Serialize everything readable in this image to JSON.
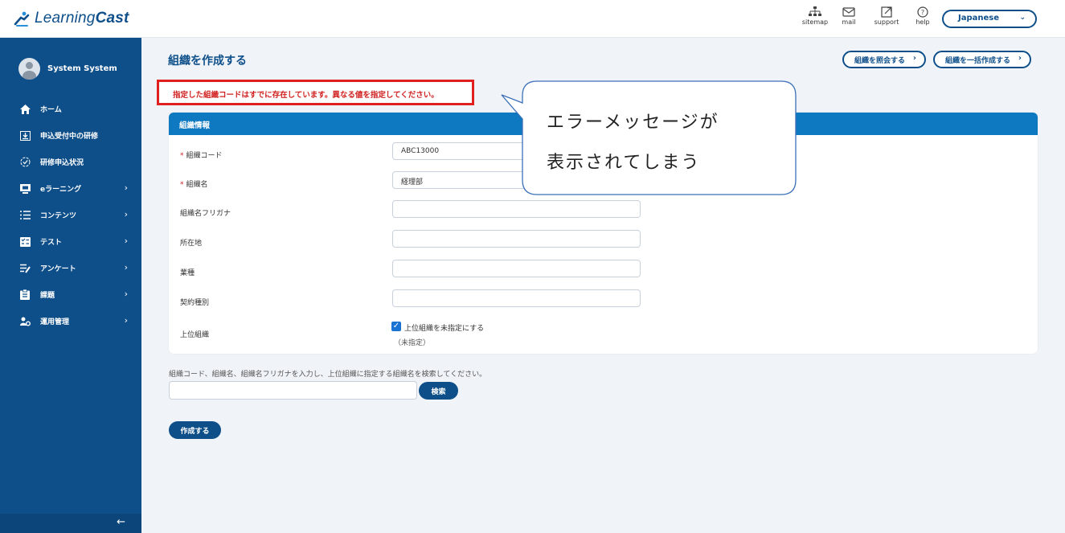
{
  "header": {
    "logo": {
      "text_light": "Learning",
      "text_bold": "Cast"
    },
    "icons": [
      {
        "name": "sitemap",
        "label": "sitemap"
      },
      {
        "name": "mail",
        "label": "mail"
      },
      {
        "name": "support",
        "label": "support"
      },
      {
        "name": "help",
        "label": "help"
      }
    ],
    "language": "Japanese"
  },
  "sidebar": {
    "user_name": "System System",
    "items": [
      {
        "label": "ホーム",
        "icon": "home-icon",
        "has_arrow": false
      },
      {
        "label": "申込受付中の研修",
        "icon": "download-icon",
        "has_arrow": false
      },
      {
        "label": "研修申込状況",
        "icon": "check-circle-icon",
        "has_arrow": false
      },
      {
        "label": "eラーニング",
        "icon": "monitor-icon",
        "has_arrow": true
      },
      {
        "label": "コンテンツ",
        "icon": "list-icon",
        "has_arrow": true
      },
      {
        "label": "テスト",
        "icon": "test-icon",
        "has_arrow": true
      },
      {
        "label": "アンケート",
        "icon": "survey-icon",
        "has_arrow": true
      },
      {
        "label": "課題",
        "icon": "clipboard-icon",
        "has_arrow": true
      },
      {
        "label": "運用管理",
        "icon": "admin-icon",
        "has_arrow": true
      }
    ],
    "collapse_glyph": "←"
  },
  "page": {
    "title": "組織を作成する",
    "actions": {
      "refer": "組織を照会する",
      "bulk_create": "組織を一括作成する",
      "arrow": "›"
    },
    "error_message": "指定した組織コードはすでに存在しています。異なる値を指定してください。"
  },
  "form": {
    "section_title": "組織情報",
    "required_mark": "*",
    "fields": [
      {
        "label": "組織コード",
        "required": true,
        "value": "ABC13000"
      },
      {
        "label": "組織名",
        "required": true,
        "value": "経理部"
      },
      {
        "label": "組織名フリガナ",
        "required": false,
        "value": ""
      },
      {
        "label": "所在地",
        "required": false,
        "value": ""
      },
      {
        "label": "業種",
        "required": false,
        "value": ""
      },
      {
        "label": "契約種別",
        "required": false,
        "value": ""
      }
    ],
    "parent": {
      "label": "上位組織",
      "checkbox_label": "上位組織を未指定にする",
      "checked": true,
      "status": "（未指定）"
    }
  },
  "search": {
    "hint": "組織コード、組織名、組織名フリガナを入力し、上位組織に指定する組織名を検索してください。",
    "value": "",
    "button": "検索"
  },
  "submit_button": "作成する",
  "callout": {
    "line1": "エラーメッセージが",
    "line2": "表示されてしまう"
  },
  "colors": {
    "brand": "#0e4f8a",
    "section_header": "#0e78c0",
    "error": "#e02020",
    "background": "#f0f4f8"
  }
}
